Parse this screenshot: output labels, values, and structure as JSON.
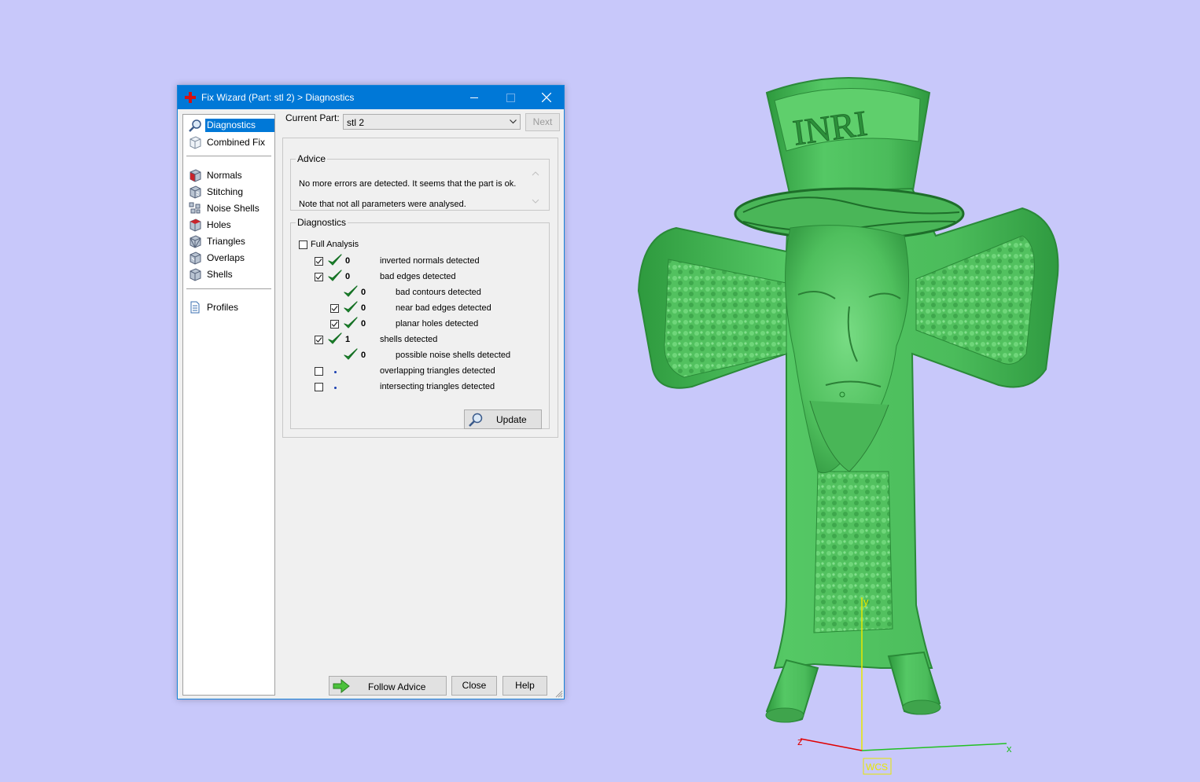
{
  "window": {
    "title": "Fix Wizard (Part: stl 2) > Diagnostics"
  },
  "nav": {
    "items": [
      {
        "label": "Diagnostics",
        "icon": "magnifier-icon"
      },
      {
        "label": "Combined Fix",
        "icon": "cube-outline-icon"
      },
      {
        "label": "Normals",
        "icon": "cube-red-icon"
      },
      {
        "label": "Stitching",
        "icon": "cube-stitch-icon"
      },
      {
        "label": "Noise Shells",
        "icon": "cube-noise-icon"
      },
      {
        "label": "Holes",
        "icon": "cube-hole-icon"
      },
      {
        "label": "Triangles",
        "icon": "cube-triangles-icon"
      },
      {
        "label": "Overlaps",
        "icon": "cube-overlap-icon"
      },
      {
        "label": "Shells",
        "icon": "cube-shells-icon"
      },
      {
        "label": "Profiles",
        "icon": "document-icon"
      }
    ]
  },
  "current_part": {
    "label": "Current Part:",
    "value": "stl 2"
  },
  "buttons": {
    "next": "Next",
    "update": "Update",
    "follow_advice": "Follow Advice",
    "close": "Close",
    "help": "Help"
  },
  "advice": {
    "legend": "Advice",
    "line1": "No more errors are detected. It seems that the part is ok.",
    "line2": "Note that not all parameters were analysed."
  },
  "diagnostics": {
    "legend": "Diagnostics",
    "full_analysis": "Full Analysis",
    "full_analysis_checked": false,
    "rows": [
      {
        "checkbox": true,
        "checked": true,
        "status": "ok",
        "count": "0",
        "label": "inverted normals detected",
        "indent": 0
      },
      {
        "checkbox": true,
        "checked": true,
        "status": "ok",
        "count": "0",
        "label": "bad edges detected",
        "indent": 0
      },
      {
        "checkbox": false,
        "checked": false,
        "status": "ok",
        "count": "0",
        "label": "bad contours detected",
        "indent": 1
      },
      {
        "checkbox": true,
        "checked": true,
        "status": "ok",
        "count": "0",
        "label": "near bad edges detected",
        "indent": 1
      },
      {
        "checkbox": true,
        "checked": true,
        "status": "ok",
        "count": "0",
        "label": "planar holes detected",
        "indent": 1
      },
      {
        "checkbox": true,
        "checked": true,
        "status": "ok",
        "count": "1",
        "label": "shells detected",
        "indent": 0
      },
      {
        "checkbox": false,
        "checked": false,
        "status": "ok",
        "count": "0",
        "label": "possible noise shells detected",
        "indent": 1
      },
      {
        "checkbox": true,
        "checked": false,
        "status": "unknown",
        "count": "",
        "label": "overlapping triangles detected",
        "indent": 0
      },
      {
        "checkbox": true,
        "checked": false,
        "status": "unknown",
        "count": "",
        "label": "intersecting triangles detected",
        "indent": 0
      }
    ]
  },
  "model": {
    "inscription": "INRI",
    "axes": {
      "x": "x",
      "y": "y",
      "z": "z",
      "wcs": "WCS"
    },
    "colors": {
      "background": "#c8c8fa",
      "model": "#4ec25e",
      "x_axis": "#22c022",
      "y_axis": "#e8e800",
      "z_axis": "#e00000"
    }
  }
}
